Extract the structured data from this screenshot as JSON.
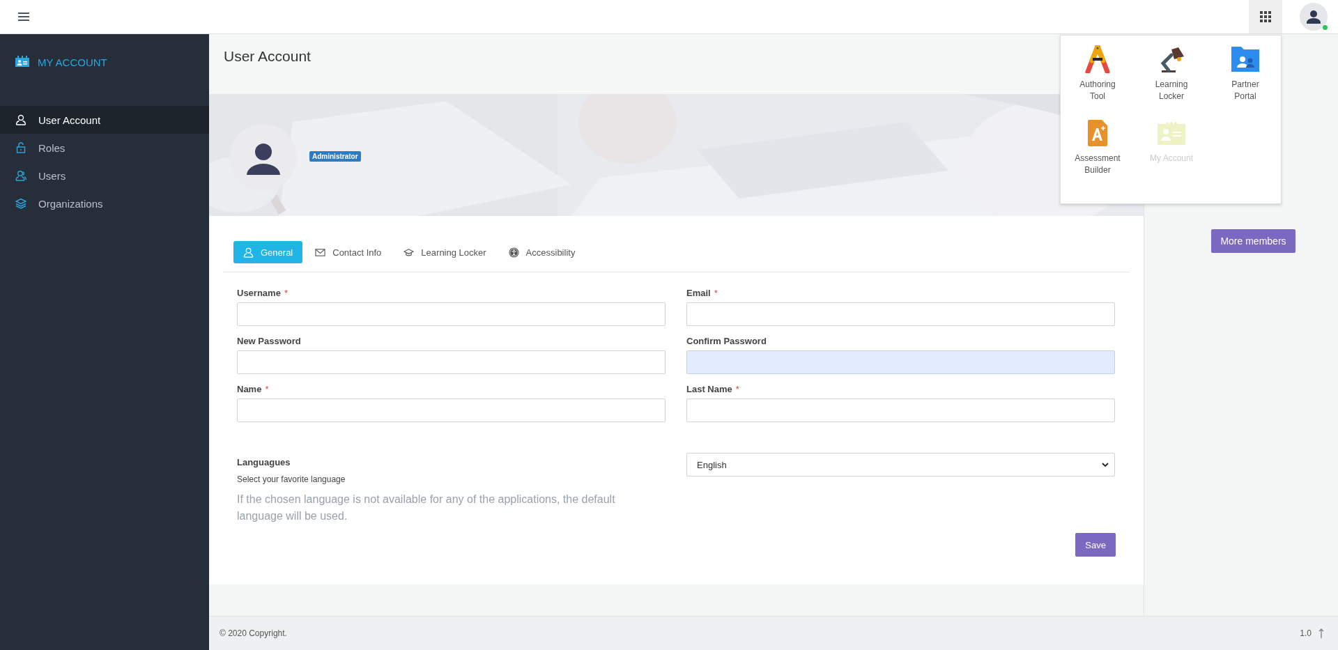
{
  "sidebar": {
    "title": "MY ACCOUNT",
    "items": [
      {
        "label": "User Account",
        "selected": true
      },
      {
        "label": "Roles",
        "selected": false
      },
      {
        "label": "Users",
        "selected": false
      },
      {
        "label": "Organizations",
        "selected": false
      }
    ]
  },
  "page_title": "User Account",
  "profile": {
    "role_badge": "Administrator"
  },
  "tabs": [
    {
      "label": "General",
      "selected": true
    },
    {
      "label": "Contact Info",
      "selected": false
    },
    {
      "label": "Learning Locker",
      "selected": false
    },
    {
      "label": "Accessibility",
      "selected": false
    }
  ],
  "fields": [
    {
      "label": "Username",
      "required_mark": "*",
      "autofilled": false
    },
    {
      "label": "Email",
      "required_mark": "*",
      "autofilled": false
    },
    {
      "label": "New Password",
      "autofilled": false
    },
    {
      "label": "Confirm Password",
      "autofilled": true
    },
    {
      "label": "Name",
      "required_mark": "*",
      "autofilled": false
    },
    {
      "label": "Last Name",
      "required_mark": "*",
      "autofilled": false
    }
  ],
  "languages": {
    "label": "Languagues",
    "hint": "Select your favorite language",
    "note": "If the chosen language is not available for any of the applications, the default language will be used.",
    "value": "English"
  },
  "save_button": "Save",
  "more_members_button": "More members",
  "app_menu": [
    {
      "label": "Authoring Tool",
      "disabled": false
    },
    {
      "label": "Learning Locker",
      "disabled": false
    },
    {
      "label": "Partner Portal",
      "disabled": false
    },
    {
      "label": "Assessment Builder",
      "disabled": false
    },
    {
      "label": "My Account",
      "disabled": true
    }
  ],
  "user_status": {
    "online": true
  },
  "footer": {
    "copyright": "© 2020 Copyright.",
    "version": "1.0"
  }
}
